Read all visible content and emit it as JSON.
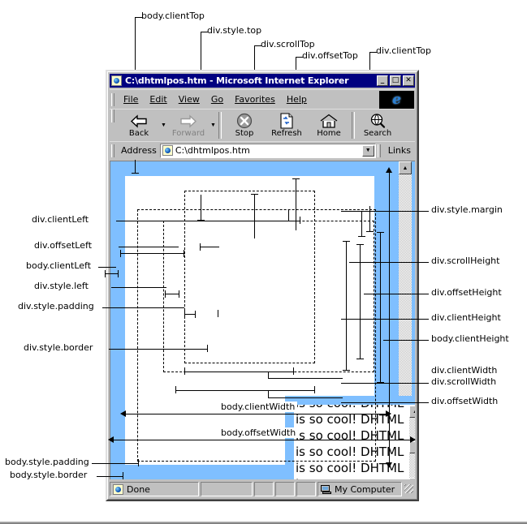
{
  "window": {
    "title": "C:\\dhtmlpos.htm - Microsoft Internet Explorer",
    "minimize_label": "_",
    "maximize_label": "□",
    "close_label": "✕",
    "icon": "ie-document-icon"
  },
  "menu": {
    "items": [
      {
        "label": "File",
        "accel": "F"
      },
      {
        "label": "Edit",
        "accel": "E"
      },
      {
        "label": "View",
        "accel": "V"
      },
      {
        "label": "Go",
        "accel": "G"
      },
      {
        "label": "Favorites",
        "accel": "a"
      },
      {
        "label": "Help",
        "accel": "H"
      }
    ],
    "logo": "e"
  },
  "toolbar": {
    "buttons": [
      {
        "label": "Back",
        "icon": "left-arrow-icon",
        "disabled": false,
        "has_caret": true
      },
      {
        "label": "Forward",
        "icon": "right-arrow-icon",
        "disabled": true,
        "has_caret": true
      },
      {
        "label": "Stop",
        "icon": "stop-circle-icon",
        "disabled": false,
        "has_caret": false
      },
      {
        "label": "Refresh",
        "icon": "refresh-page-icon",
        "disabled": false,
        "has_caret": false
      },
      {
        "label": "Home",
        "icon": "house-icon",
        "disabled": false,
        "has_caret": false
      },
      {
        "label": "Search",
        "icon": "magnifier-globe-icon",
        "disabled": false,
        "has_caret": false
      }
    ]
  },
  "address_bar": {
    "label": "Address",
    "value": "C:\\dhtmlpos.htm",
    "icon": "ie-document-icon",
    "dropdown_icon": "chevron-down-icon",
    "links_label": "Links"
  },
  "document": {
    "div_text": "is so cool! DHTML is so cool! DHTML is so cool! DHTML is so cool! DHTML is so cool! DHTML is"
  },
  "status_bar": {
    "status": "Done",
    "zone": "My Computer",
    "status_icon": "ie-document-icon",
    "zone_icon": "my-computer-icon"
  },
  "annotations": {
    "top": [
      "body.clientTop",
      "div.style.top",
      "div.scrollTop",
      "div.offsetTop",
      "div.clientTop"
    ],
    "left": [
      "div.clientLeft",
      "div.offsetLeft",
      "body.clientLeft",
      "div.style.left",
      "div.style.padding",
      "div.style.border"
    ],
    "bottom_left": [
      "body.style.padding",
      "body.style.border"
    ],
    "right": [
      "div.style.margin",
      "div.scrollHeight",
      "div.offsetHeight",
      "div.clientHeight",
      "body.clientHeight",
      "div.clientWidth",
      "div.scrollWidth",
      "div.offsetWidth"
    ],
    "inline": [
      "body.clientWidth",
      "body.offsetWidth"
    ]
  },
  "colors": {
    "titlebar": "#000080",
    "chrome": "#c0c0c0",
    "body_border_blue": "#7fbfff",
    "page_white": "#ffffff",
    "ink": "#000000"
  }
}
